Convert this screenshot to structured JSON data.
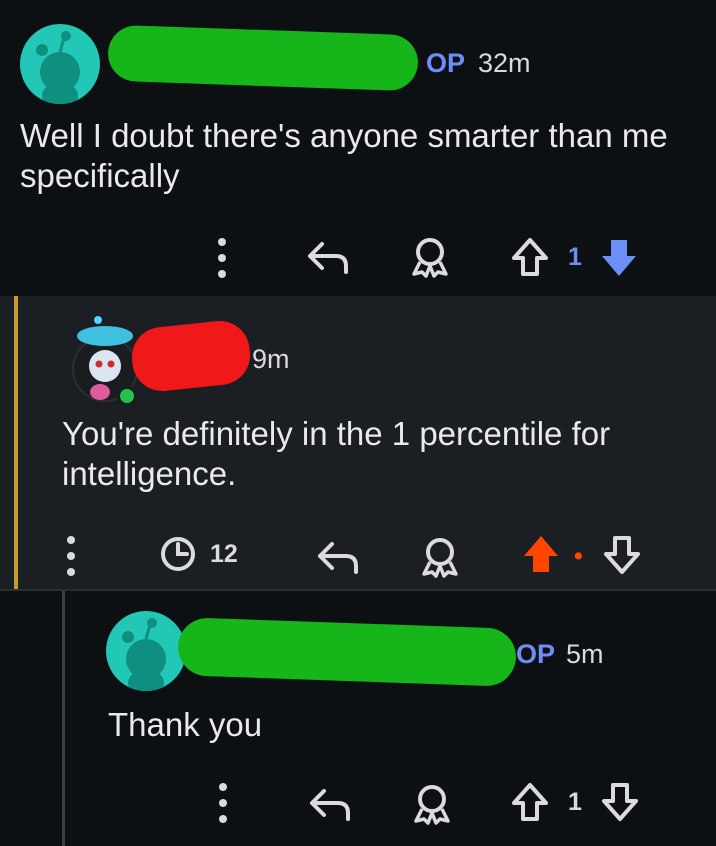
{
  "comments": [
    {
      "author_tag": "OP",
      "time": "32m",
      "body": "Well I doubt there's anyone smarter than me specifically",
      "vote_count": "1",
      "vote_color": "#6d8df7"
    },
    {
      "time": "9m",
      "body": "You're definitely in the 1 percentile for intelligence.",
      "awards_count": "12",
      "vote_count": "•",
      "upvote_color": "#ff4500"
    },
    {
      "author_tag": "OP",
      "time": "5m",
      "body": "Thank you",
      "vote_count": "1"
    }
  ],
  "icons": [
    "avatar-icon",
    "more-options-icon",
    "reply-icon",
    "award-icon",
    "upvote-icon",
    "downvote-icon",
    "clock-award-icon"
  ]
}
